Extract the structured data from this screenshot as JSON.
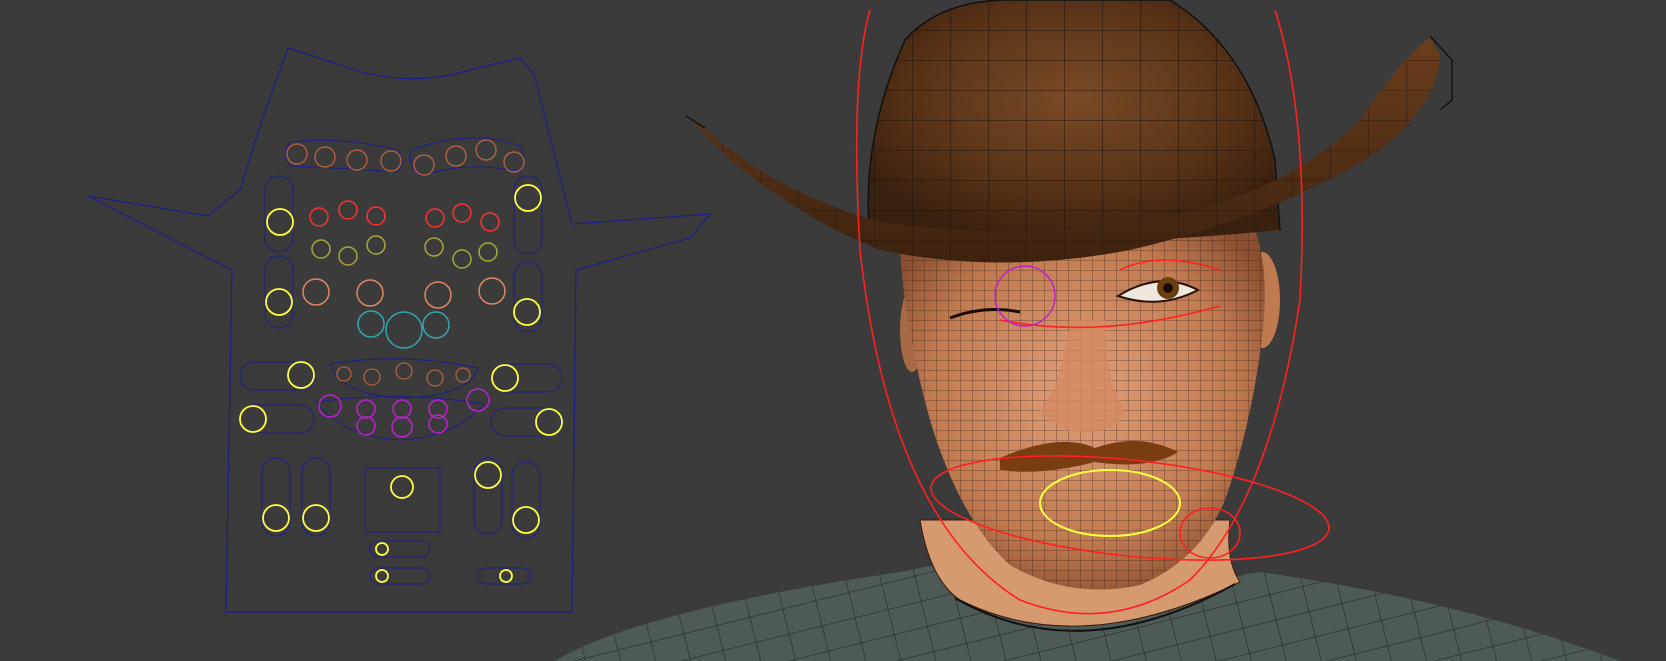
{
  "viewport": {
    "background": "#3b3b3b",
    "picker_outline_color": "#1f1f8a",
    "rig_curve_color": "#ff2020"
  },
  "control_colors": {
    "yellow": "#ffff40",
    "red": "#ff3030",
    "orange": "#e08860",
    "olive": "#a8a838",
    "cyan": "#30a8b0",
    "magenta": "#c020d0",
    "brown": "#b06040"
  },
  "character": {
    "hat_color": "#5a3418",
    "skin_color": "#c8865c",
    "shirt_color": "#4d5a55",
    "wire_color": "#1a0a05"
  }
}
